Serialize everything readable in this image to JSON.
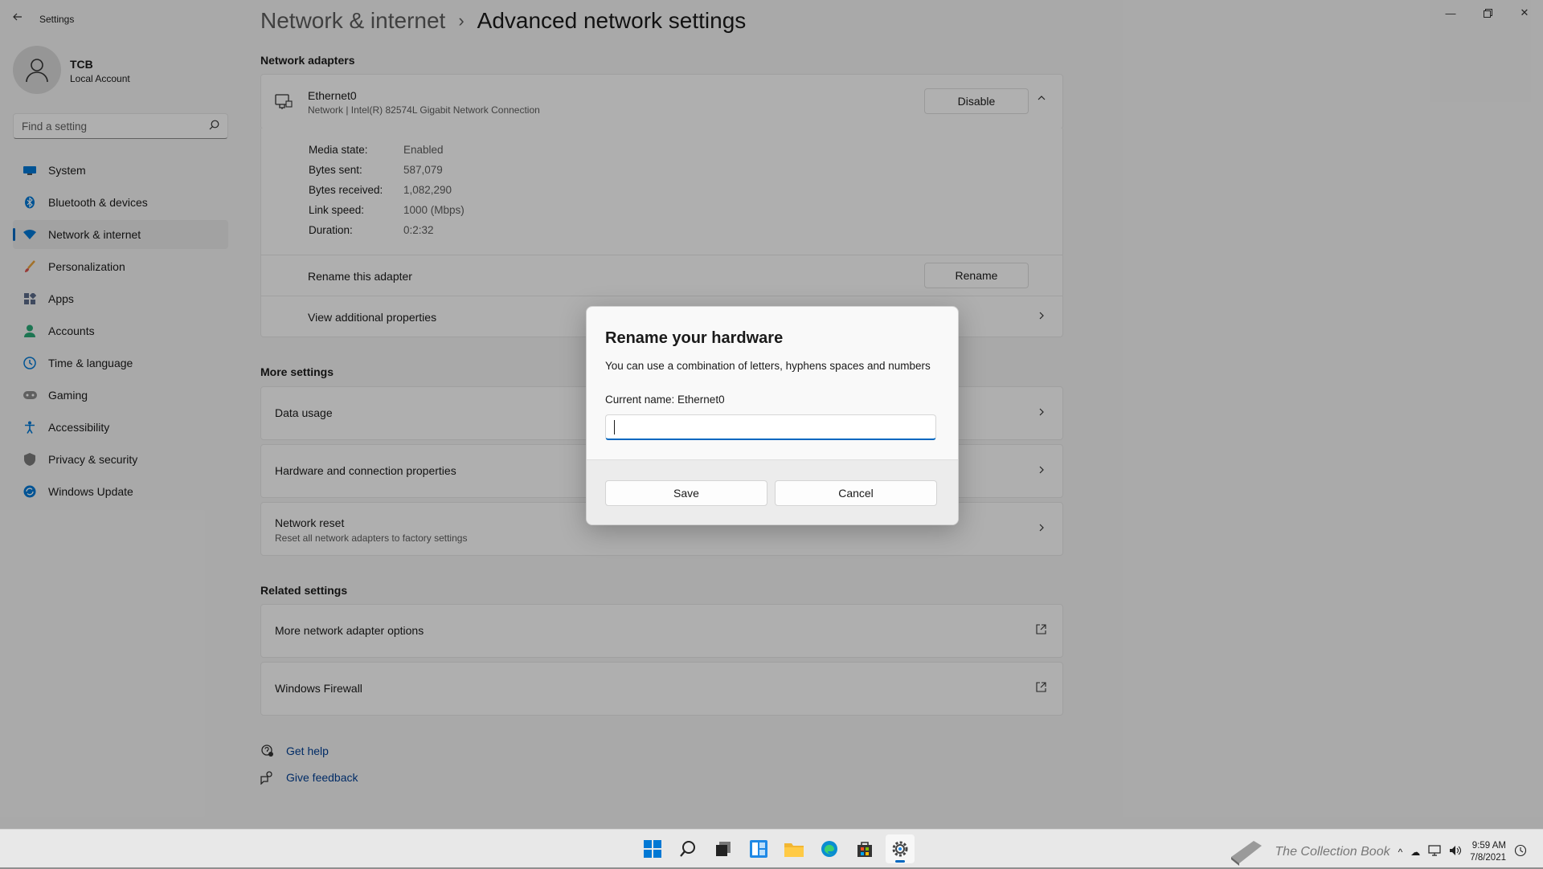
{
  "window": {
    "app_title": "Settings"
  },
  "user": {
    "name": "TCB",
    "account_type": "Local Account"
  },
  "search": {
    "placeholder": "Find a setting"
  },
  "sidebar": {
    "items": [
      {
        "label": "System",
        "icon": "monitor-icon",
        "active": false
      },
      {
        "label": "Bluetooth & devices",
        "icon": "bluetooth-icon",
        "active": false
      },
      {
        "label": "Network & internet",
        "icon": "wifi-icon",
        "active": true
      },
      {
        "label": "Personalization",
        "icon": "brush-icon",
        "active": false
      },
      {
        "label": "Apps",
        "icon": "apps-icon",
        "active": false
      },
      {
        "label": "Accounts",
        "icon": "person-icon",
        "active": false
      },
      {
        "label": "Time & language",
        "icon": "globe-clock-icon",
        "active": false
      },
      {
        "label": "Gaming",
        "icon": "gamepad-icon",
        "active": false
      },
      {
        "label": "Accessibility",
        "icon": "accessibility-icon",
        "active": false
      },
      {
        "label": "Privacy & security",
        "icon": "shield-icon",
        "active": false
      },
      {
        "label": "Windows Update",
        "icon": "update-icon",
        "active": false
      }
    ]
  },
  "breadcrumb": {
    "parent": "Network & internet",
    "separator": "›",
    "current": "Advanced network settings"
  },
  "network_adapters": {
    "title": "Network adapters",
    "adapter": {
      "name": "Ethernet0",
      "description": "Network | Intel(R) 82574L Gigabit Network Connection",
      "disable_label": "Disable",
      "properties": [
        {
          "key": "Media state:",
          "value": "Enabled"
        },
        {
          "key": "Bytes sent:",
          "value": "587,079"
        },
        {
          "key": "Bytes received:",
          "value": "1,082,290"
        },
        {
          "key": "Link speed:",
          "value": "1000 (Mbps)"
        },
        {
          "key": "Duration:",
          "value": "0:2:32"
        }
      ],
      "rename_text": "Rename this adapter",
      "rename_label": "Rename",
      "view_props": "View additional properties"
    }
  },
  "more_settings": {
    "title": "More settings",
    "data_usage": "Data usage",
    "hardware": "Hardware and connection properties",
    "reset_title": "Network reset",
    "reset_desc": "Reset all network adapters to factory settings"
  },
  "related_settings": {
    "title": "Related settings",
    "adapter_options": "More network adapter options",
    "firewall": "Windows Firewall"
  },
  "help": {
    "get_help": "Get help",
    "feedback": "Give feedback"
  },
  "dialog": {
    "title": "Rename your hardware",
    "description": "You can use a combination of letters, hyphens spaces and numbers",
    "current_name": "Current name: Ethernet0",
    "input_value": "",
    "save_label": "Save",
    "cancel_label": "Cancel"
  },
  "taskbar": {
    "time": "9:59 AM",
    "date": "7/8/2021",
    "watermark": "The Collection Book"
  },
  "colors": {
    "accent": "#0067c0",
    "link": "#003e92"
  }
}
